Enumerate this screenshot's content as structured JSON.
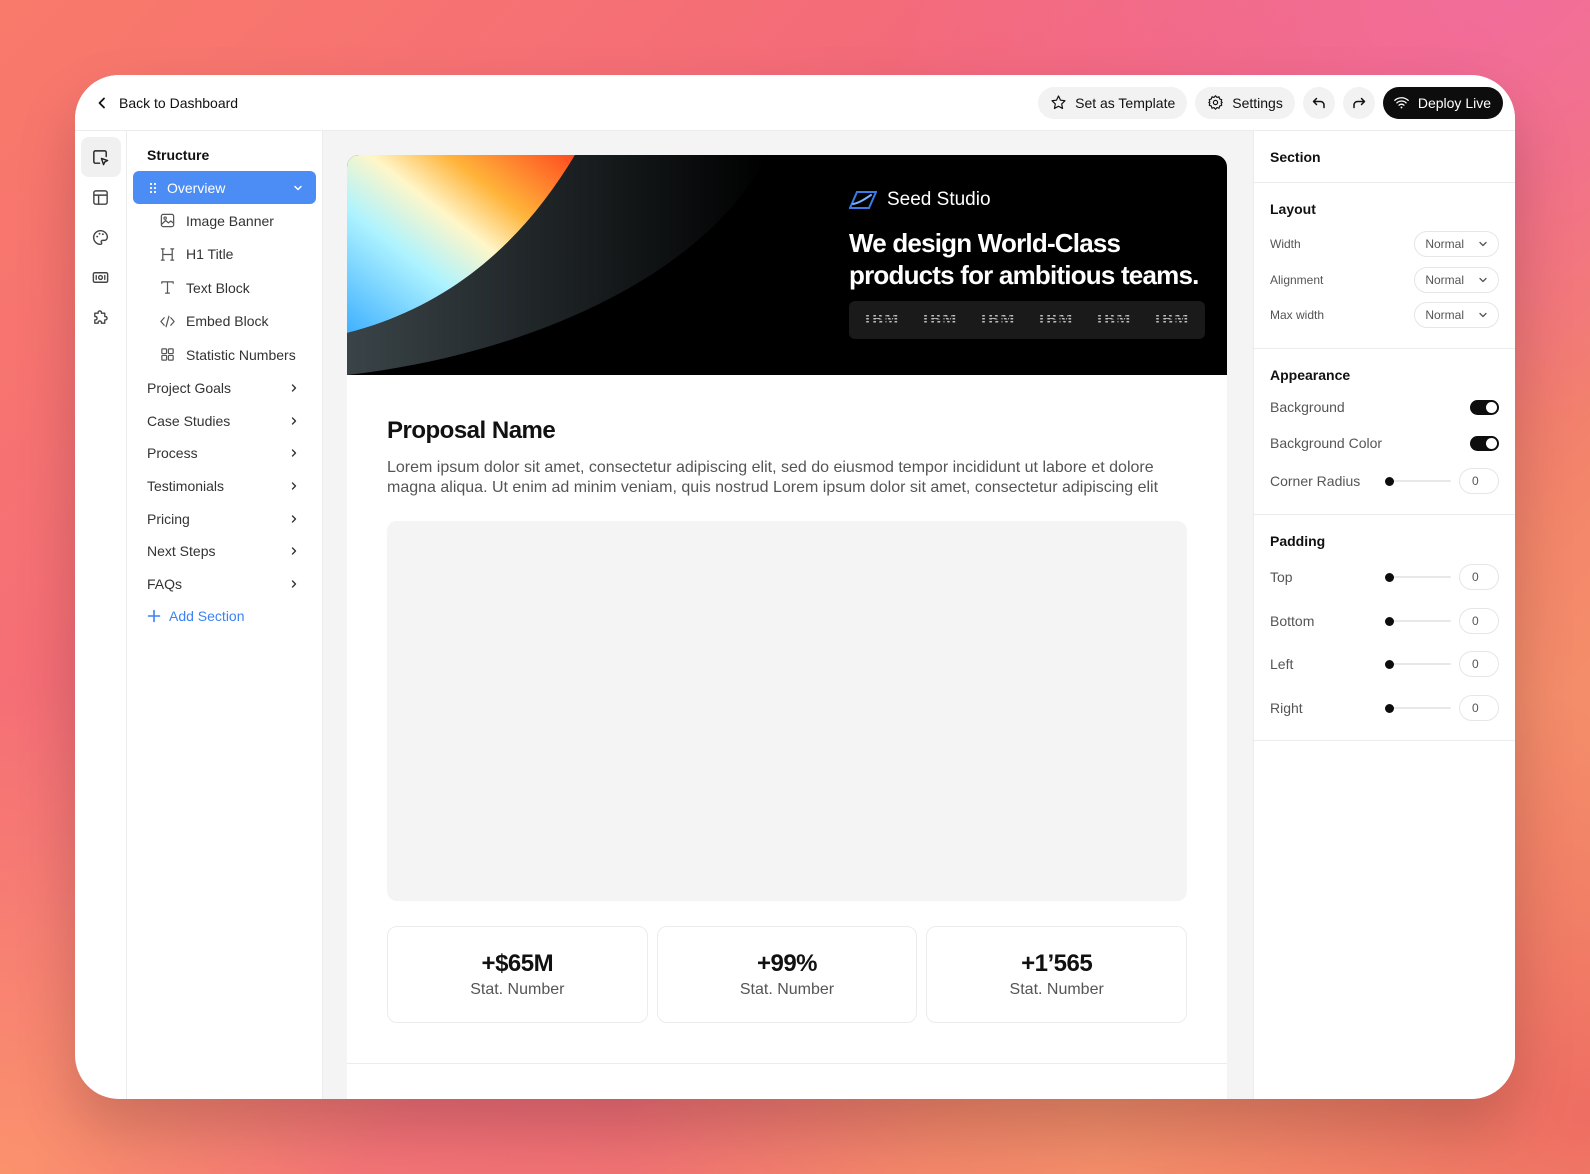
{
  "topbar": {
    "back_label": "Back to Dashboard",
    "set_template_label": "Set as Template",
    "settings_label": "Settings",
    "deploy_label": "Deploy Live"
  },
  "rail": {
    "icons": [
      "select-icon",
      "layout-icon",
      "palette-icon",
      "media-icon",
      "puzzle-icon"
    ]
  },
  "structure": {
    "title": "Structure",
    "active_section": "Overview",
    "sub_items": [
      {
        "icon": "image-icon",
        "label": "Image Banner"
      },
      {
        "icon": "heading-icon",
        "label": "H1 Title"
      },
      {
        "icon": "text-icon",
        "label": "Text Block"
      },
      {
        "icon": "code-icon",
        "label": "Embed Block"
      },
      {
        "icon": "grid-icon",
        "label": "Statistic Numbers"
      }
    ],
    "sections": [
      "Project Goals",
      "Case Studies",
      "Process",
      "Testimonials",
      "Pricing",
      "Next Steps",
      "FAQs"
    ],
    "add_section_label": "Add Section"
  },
  "banner": {
    "brand": "Seed Studio",
    "headline_line1": "We design World-Class",
    "headline_line2": "products for ambitious teams.",
    "logos": [
      "IBM",
      "IBM",
      "IBM",
      "IBM",
      "IBM",
      "IBM"
    ]
  },
  "content": {
    "title": "Proposal Name",
    "body": "Lorem ipsum dolor sit amet, consectetur adipiscing elit, sed do eiusmod tempor incididunt ut labore et dolore magna aliqua. Ut enim ad minim veniam, quis nostrud Lorem ipsum dolor sit amet, consectetur adipiscing elit",
    "stats": [
      {
        "value": "+$65M",
        "caption": "Stat. Number"
      },
      {
        "value": "+99%",
        "caption": "Stat. Number"
      },
      {
        "value": "+1’565",
        "caption": "Stat. Number"
      }
    ]
  },
  "props": {
    "title": "Section",
    "layout": {
      "heading": "Layout",
      "width_label": "Width",
      "width_value": "Normal",
      "alignment_label": "Alignment",
      "alignment_value": "Normal",
      "maxwidth_label": "Max width",
      "maxwidth_value": "Normal"
    },
    "appearance": {
      "heading": "Appearance",
      "background_label": "Background",
      "background_on": true,
      "bgcolor_label": "Background Color",
      "bgcolor_on": true,
      "radius_label": "Corner Radius",
      "radius_value": "0"
    },
    "padding": {
      "heading": "Padding",
      "top_label": "Top",
      "top_value": "0",
      "bottom_label": "Bottom",
      "bottom_value": "0",
      "left_label": "Left",
      "left_value": "0",
      "right_label": "Right",
      "right_value": "0"
    }
  },
  "colors": {
    "accent": "#4b8cf5",
    "link": "#3a82f6",
    "dark": "#0d0d0d"
  }
}
